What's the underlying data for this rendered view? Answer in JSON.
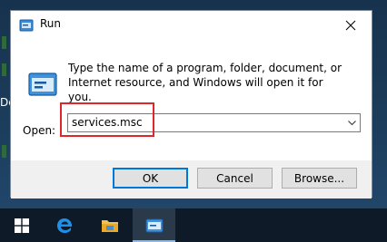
{
  "window": {
    "title": "Run",
    "description": "Type the name of a program, folder, document, or Internet resource, and Windows will open it for you.",
    "open_label": "Open:",
    "open_value": "services.msc"
  },
  "buttons": {
    "ok": "OK",
    "cancel": "Cancel",
    "browse": "Browse..."
  },
  "desktop": {
    "peek_text": "De"
  },
  "taskbar": {
    "items": [
      {
        "icon": "windows-start-icon"
      },
      {
        "icon": "edge-browser-icon"
      },
      {
        "icon": "file-explorer-icon"
      },
      {
        "icon": "run-app-icon"
      }
    ]
  },
  "colors": {
    "highlight": "#e0262a",
    "accent": "#0078d7",
    "taskbar": "#0e1a27"
  }
}
